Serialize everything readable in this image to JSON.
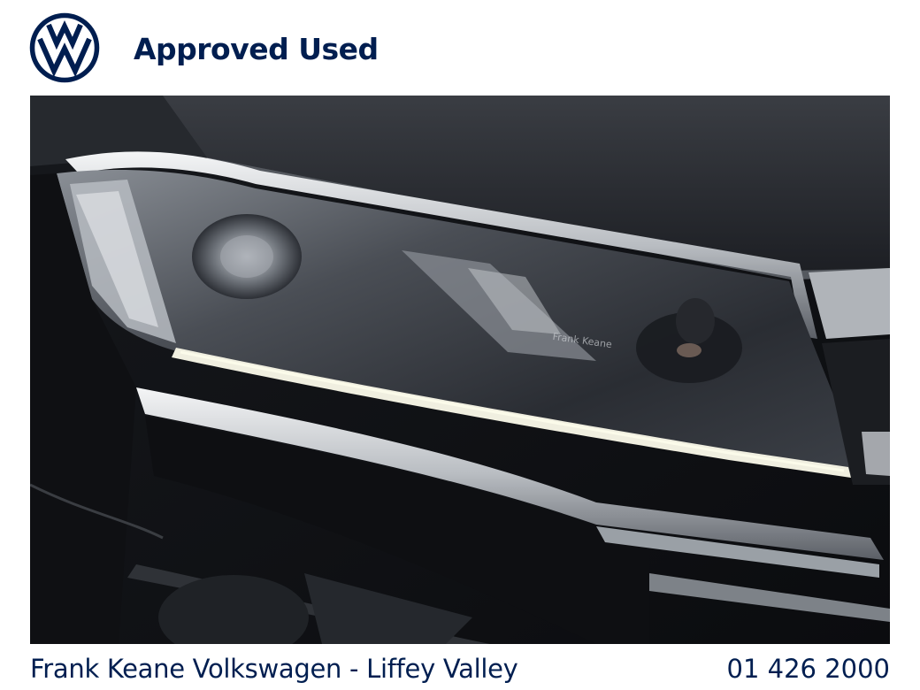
{
  "header": {
    "brand_icon": "vw-logo-icon",
    "title": "Approved Used"
  },
  "photo": {
    "reflection_text": "Frank Keane"
  },
  "footer": {
    "dealer": "Frank Keane Volkswagen - Liffey Valley",
    "phone": "01 426 2000"
  },
  "colors": {
    "brand": "#001e50",
    "background": "#ffffff"
  }
}
